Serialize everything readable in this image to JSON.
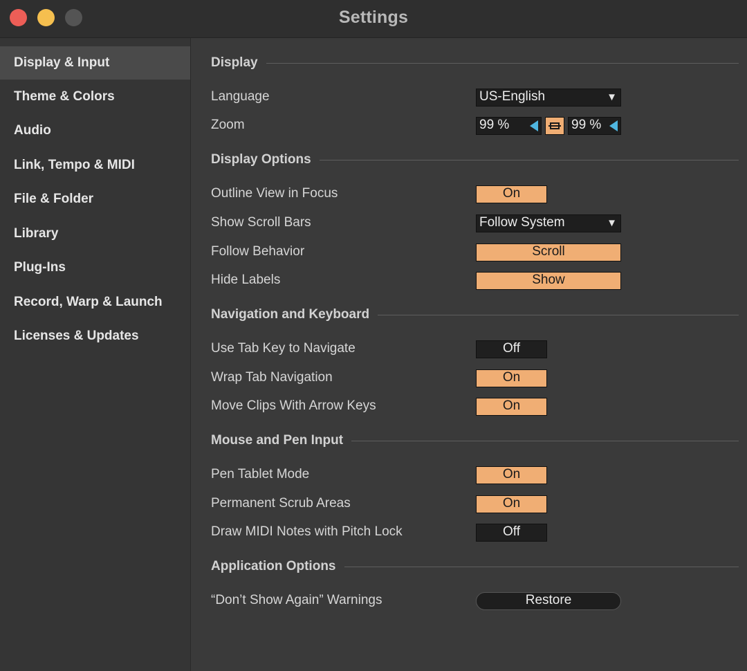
{
  "window": {
    "title": "Settings"
  },
  "sidebar": {
    "items": [
      {
        "label": "Display & Input"
      },
      {
        "label": "Theme & Colors"
      },
      {
        "label": "Audio"
      },
      {
        "label": "Link, Tempo & MIDI"
      },
      {
        "label": "File & Folder"
      },
      {
        "label": "Library"
      },
      {
        "label": "Plug-Ins"
      },
      {
        "label": "Record, Warp & Launch"
      },
      {
        "label": "Licenses & Updates"
      }
    ],
    "active_index": 0
  },
  "sections": {
    "display": {
      "title": "Display",
      "language": {
        "label": "Language",
        "value": "US-English"
      },
      "zoom": {
        "label": "Zoom",
        "value1": "99 %",
        "value2": "99 %"
      }
    },
    "display_options": {
      "title": "Display Options",
      "outline_view": {
        "label": "Outline View in Focus",
        "value": "On"
      },
      "scroll_bars": {
        "label": "Show Scroll Bars",
        "value": "Follow System"
      },
      "follow_behavior": {
        "label": "Follow Behavior",
        "value": "Scroll"
      },
      "hide_labels": {
        "label": "Hide Labels",
        "value": "Show"
      }
    },
    "navigation": {
      "title": "Navigation and Keyboard",
      "tab_key": {
        "label": "Use Tab Key to Navigate",
        "value": "Off"
      },
      "wrap_tab": {
        "label": "Wrap Tab Navigation",
        "value": "On"
      },
      "move_clips": {
        "label": "Move Clips With Arrow Keys",
        "value": "On"
      }
    },
    "mouse_pen": {
      "title": "Mouse and Pen Input",
      "pen_tablet": {
        "label": "Pen Tablet Mode",
        "value": "On"
      },
      "scrub_areas": {
        "label": "Permanent Scrub Areas",
        "value": "On"
      },
      "pitch_lock": {
        "label": "Draw MIDI Notes with Pitch Lock",
        "value": "Off"
      }
    },
    "application": {
      "title": "Application Options",
      "warnings": {
        "label": "“Don’t Show Again” Warnings",
        "value": "Restore"
      }
    }
  },
  "colors": {
    "accent_on": "#f0ae74",
    "control_off": "#1f1f1f",
    "zoom_arrow": "#4fb6e0",
    "background": "#3a3a3a"
  }
}
